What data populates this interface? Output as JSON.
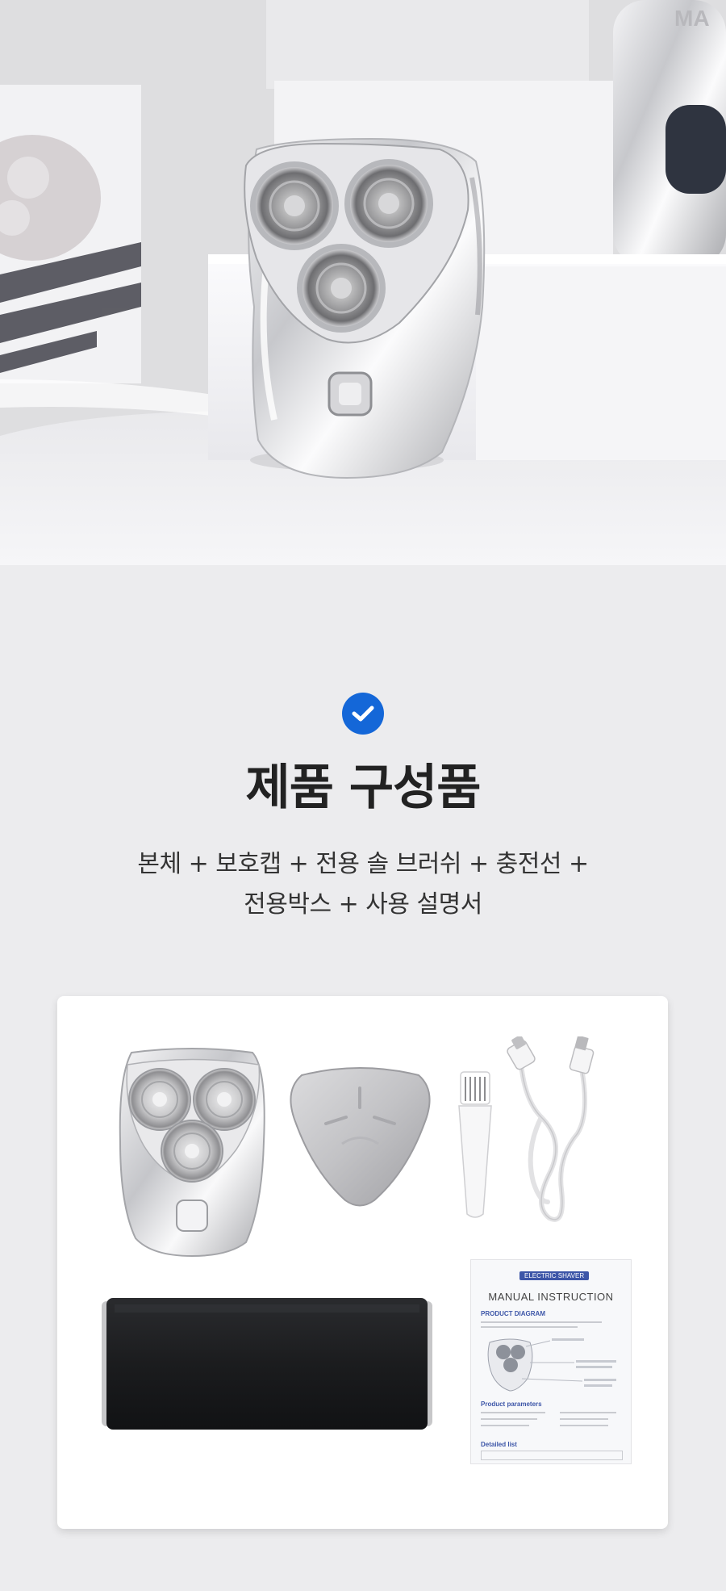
{
  "hero": {
    "brand_fragment": "MA",
    "image_alt": "silver electric shaver on white pedestal"
  },
  "section": {
    "check_icon": "check-circle-icon",
    "title": "제품 구성품",
    "desc_line1": "본체 + 보호캡 + 전용 솔 브러쉬 + 충전선 +",
    "desc_line2": "전용박스 + 사용 설명서"
  },
  "components": {
    "items": [
      "shaver-body",
      "protective-cap",
      "cleaning-brush",
      "charging-cable",
      "storage-box",
      "user-manual"
    ],
    "manual": {
      "badge": "ELECTRIC SHAVER",
      "title": "MANUAL  INSTRUCTION",
      "product_diagram": "PRODUCT DIAGRAM",
      "product_parameters": "Product parameters",
      "detailed_list": "Detailed list"
    }
  },
  "colors": {
    "accent": "#1467d8",
    "background": "#ececee",
    "card": "#ffffff",
    "title": "#222222"
  }
}
